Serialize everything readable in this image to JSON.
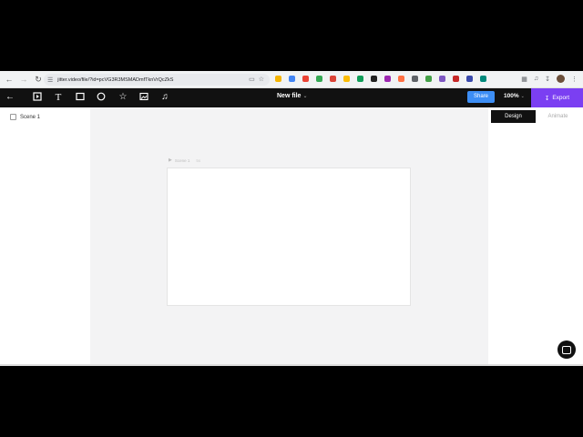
{
  "browser": {
    "url": "jitter.video/file/?id=pcVG3R3MSMADmfTknVrQcZkS",
    "icons": {
      "back": "arrow-left-icon",
      "forward": "arrow-right-icon",
      "reload": "reload-icon",
      "cast": "cast-icon",
      "bookmark": "star-icon",
      "extensions": "puzzle-icon",
      "download": "download-icon",
      "menu": "kebab-menu-icon"
    },
    "extension_colors": [
      "#f4b400",
      "#4285f4",
      "#ea4335",
      "#34a853",
      "#db4437",
      "#fbbc05",
      "#0f9d58",
      "#222222",
      "#9c27b0",
      "#ff7043",
      "#5f6368",
      "#43a047",
      "#7e57c2",
      "#c62828",
      "#3949ab",
      "#00897b"
    ]
  },
  "toolbar": {
    "title": "New file",
    "share_label": "Share",
    "zoom_label": "100%",
    "export_label": "Export",
    "tools": [
      "back-arrow-icon",
      "frame-icon",
      "text-icon",
      "rectangle-icon",
      "ellipse-icon",
      "star-icon",
      "image-icon",
      "music-note-icon"
    ]
  },
  "colors": {
    "share": "#3d8ef5",
    "export": "#7b3ff2",
    "toolbar_bg": "#111111",
    "canvas_bg": "#f3f3f4"
  },
  "left_panel": {
    "scenes": [
      {
        "label": "Scene 1"
      }
    ]
  },
  "canvas": {
    "frame_name": "Scene 1",
    "frame_duration": "5s"
  },
  "right_panel": {
    "tabs": [
      {
        "label": "Design",
        "active": true
      },
      {
        "label": "Animate",
        "active": false
      }
    ]
  }
}
